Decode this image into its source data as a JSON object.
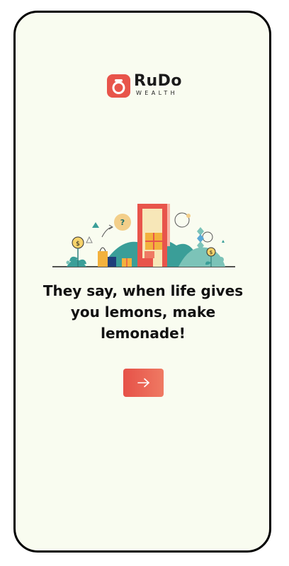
{
  "brand": {
    "name": "RuDo",
    "subtitle": "WEALTH",
    "color": "#e8544b"
  },
  "onboarding": {
    "headline": "They say, when life gives you lemons, make lemonade!",
    "illustration_icons": [
      "question-bubble",
      "dollar-coin",
      "shopping-bags",
      "gift-box",
      "door-frame",
      "plants"
    ]
  },
  "next_button": {
    "icon": "arrow-right-icon",
    "color": "#e65148"
  }
}
